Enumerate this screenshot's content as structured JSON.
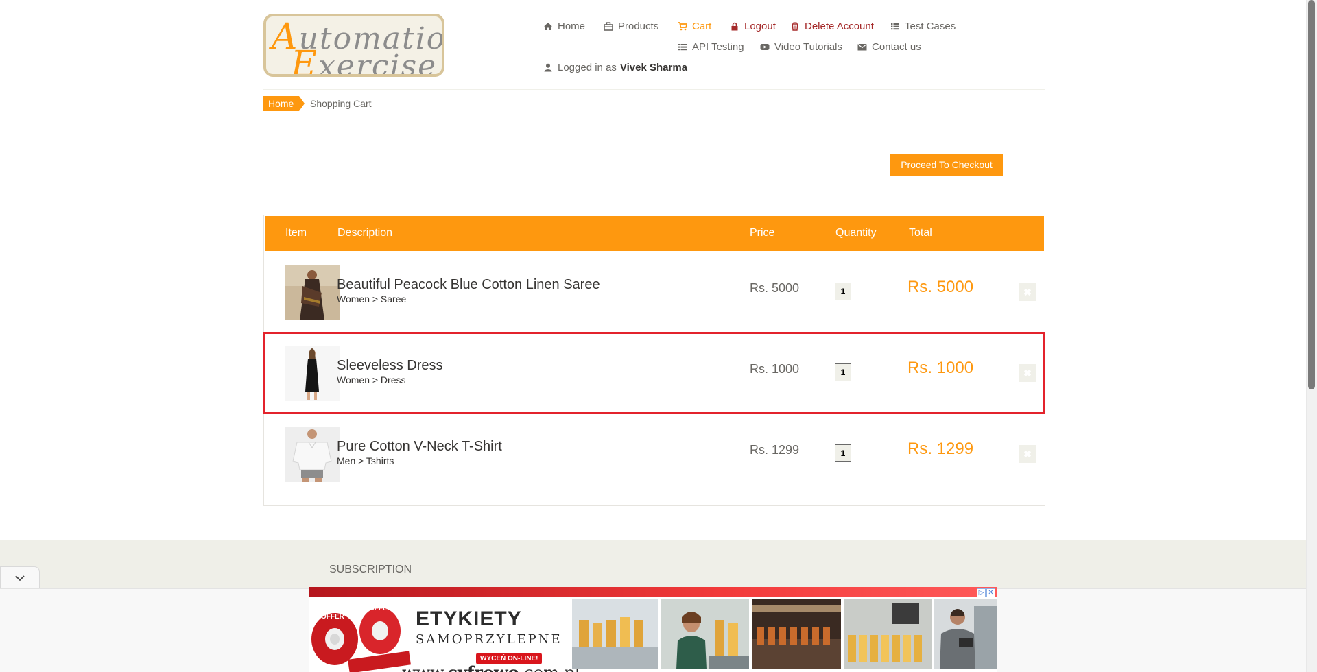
{
  "logo": {
    "line1_cap": "A",
    "line1_rest": "utomation",
    "line2_cap": "E",
    "line2_rest": "xercise"
  },
  "nav": {
    "home": "Home",
    "products": "Products",
    "cart": "Cart",
    "logout": "Logout",
    "delete_account": "Delete Account",
    "test_cases": "Test Cases",
    "api_testing": "API Testing",
    "video_tutorials": "Video Tutorials",
    "contact_us": "Contact us",
    "logged_in_prefix": "Logged in as",
    "logged_in_user": "Vivek Sharma"
  },
  "breadcrumb": {
    "home": "Home",
    "current": "Shopping Cart"
  },
  "checkout_button": "Proceed To Checkout",
  "cart": {
    "headers": {
      "item": "Item",
      "description": "Description",
      "price": "Price",
      "quantity": "Quantity",
      "total": "Total"
    },
    "rows": [
      {
        "name": "Beautiful Peacock Blue Cotton Linen Saree",
        "category": "Women > Saree",
        "price": "Rs. 5000",
        "quantity": "1",
        "total": "Rs. 5000",
        "delete_icon": "close-icon"
      },
      {
        "name": "Sleeveless Dress",
        "category": "Women > Dress",
        "price": "Rs. 1000",
        "quantity": "1",
        "total": "Rs. 1000",
        "delete_icon": "close-icon"
      },
      {
        "name": "Pure Cotton V-Neck T-Shirt",
        "category": "Men > Tshirts",
        "price": "Rs. 1299",
        "quantity": "1",
        "total": "Rs. 1299",
        "delete_icon": "close-icon"
      }
    ]
  },
  "footer": {
    "subscription_heading": "SUBSCRIPTION"
  },
  "ad": {
    "title": "ETYKIETY",
    "subtitle": "SAMOPRZYLEPNE",
    "cta": "WYCEŃ ON-LINE!",
    "url_prefix": "www.",
    "url_brand": "cyfrowo",
    "url_suffix": ".com.pl",
    "roll_label": "OFFER",
    "adchoices_icon": "adchoices-icon",
    "close_icon": "close-icon"
  },
  "colors": {
    "accent": "#FE980F",
    "danger": "#A52A2A",
    "highlight": "#E3232C",
    "footer_bg": "#EFEFE8"
  }
}
